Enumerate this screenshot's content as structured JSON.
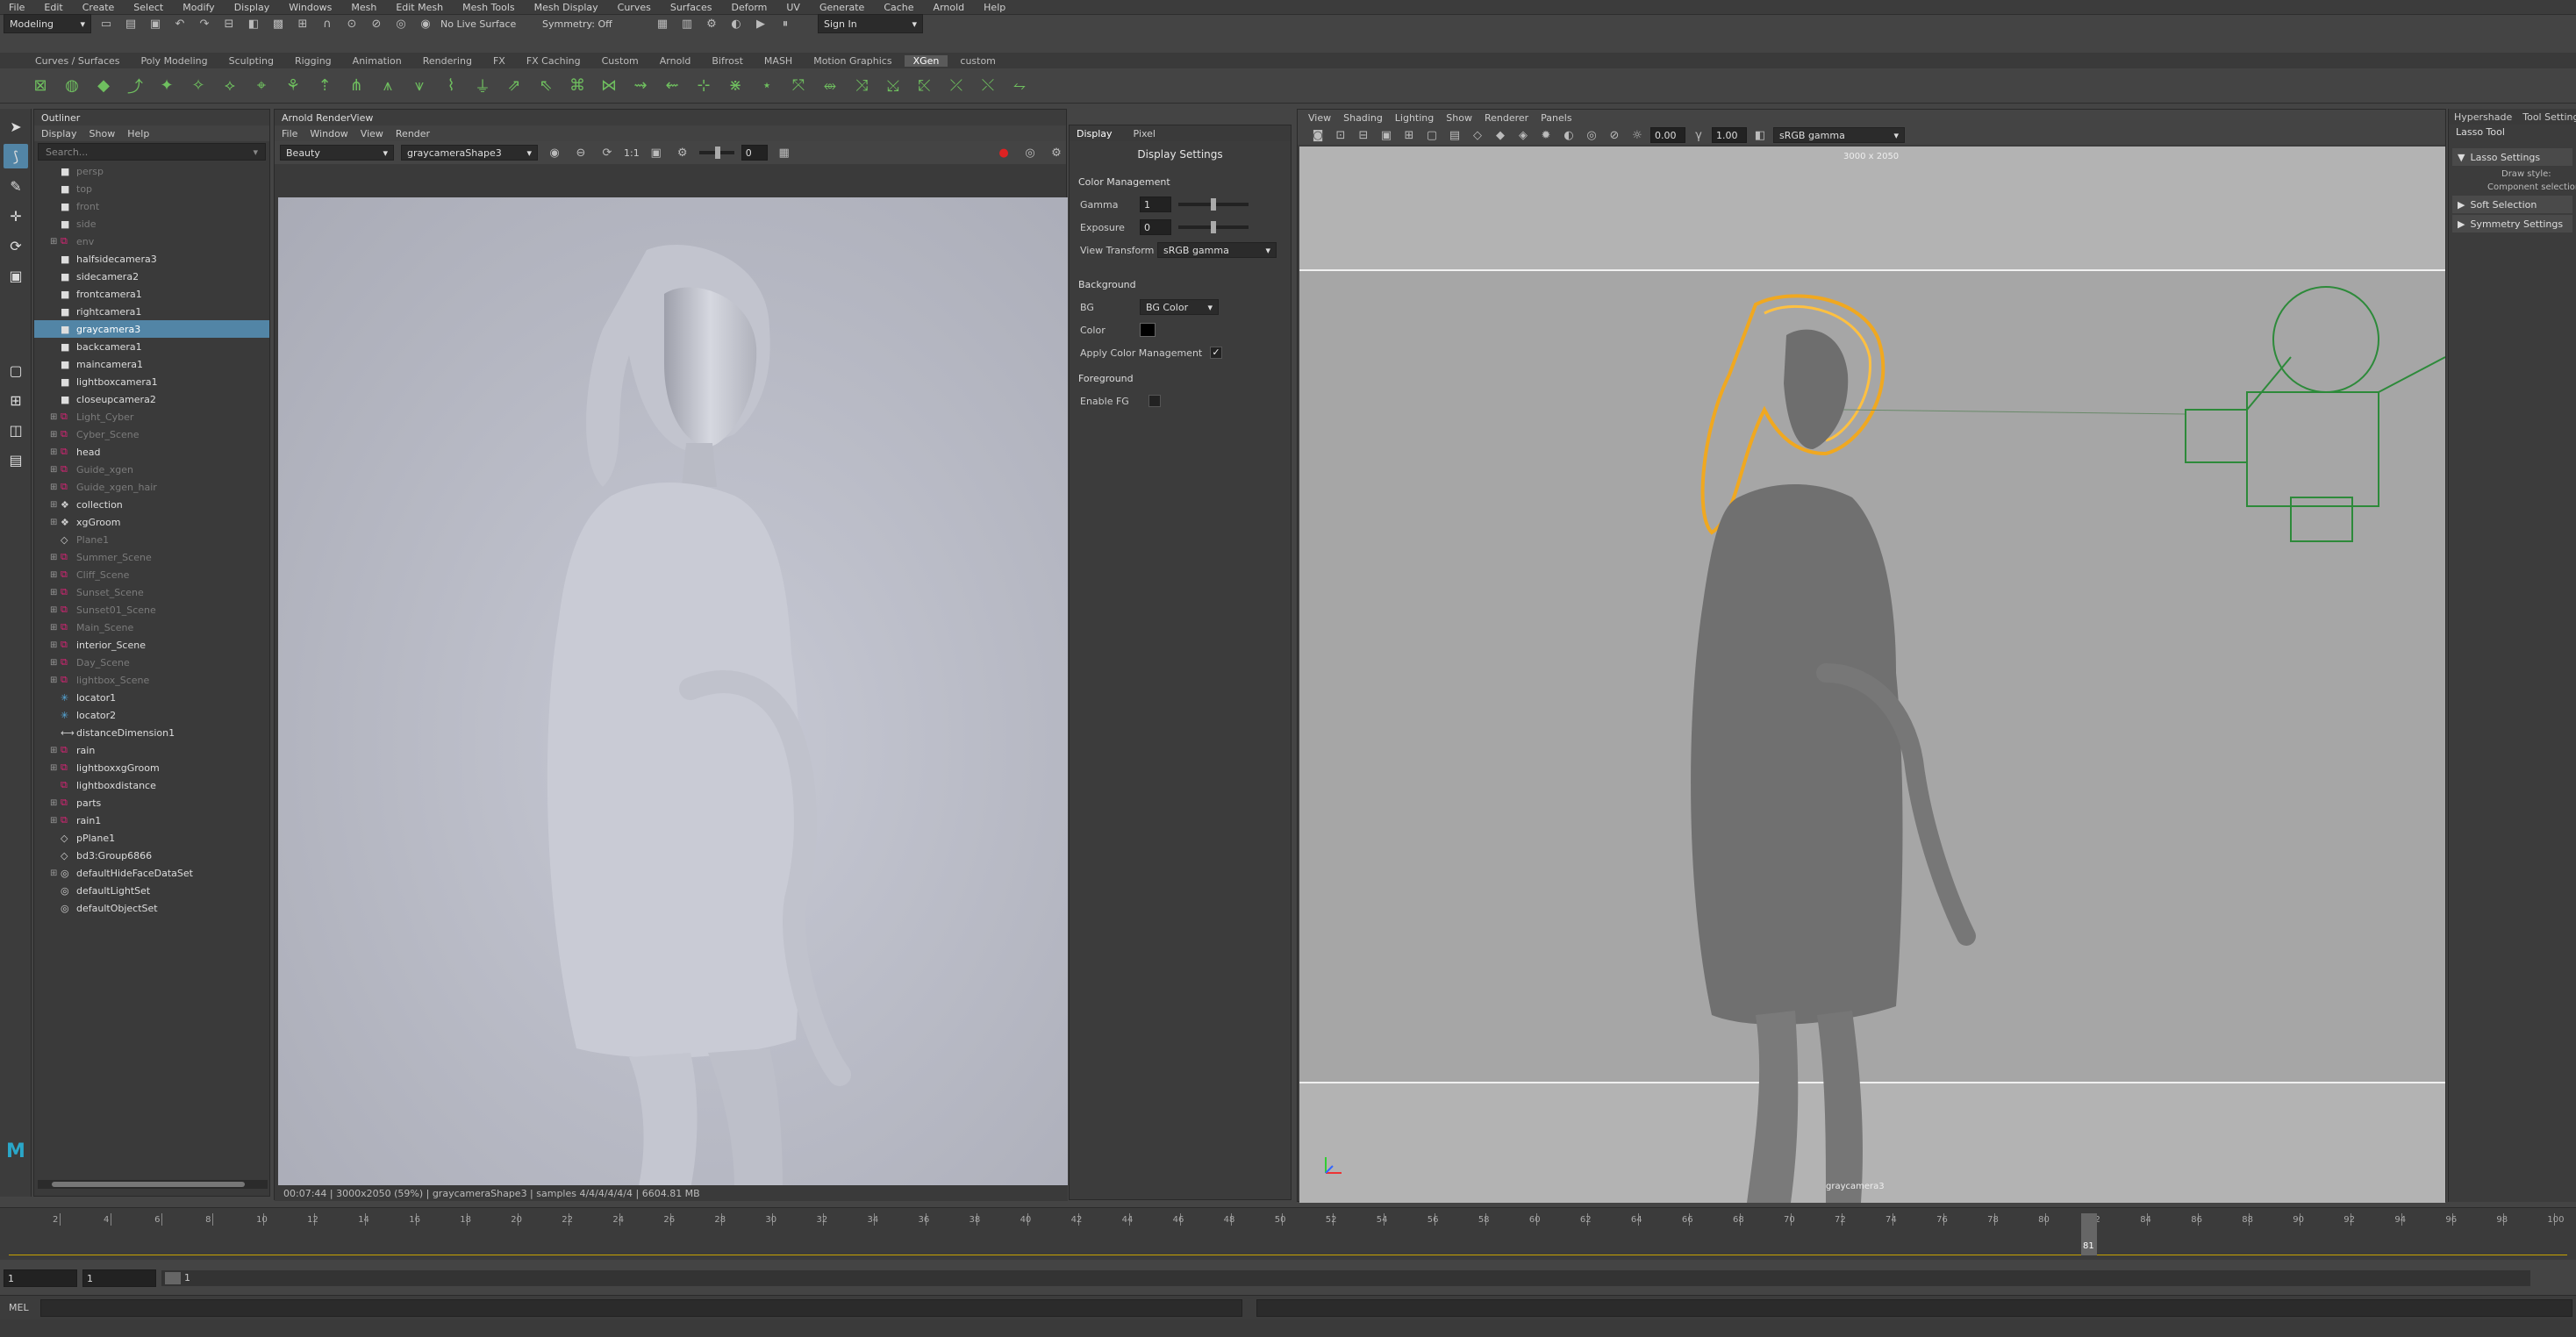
{
  "menubar": [
    "File",
    "Edit",
    "Create",
    "Select",
    "Modify",
    "Display",
    "Windows",
    "Mesh",
    "Edit Mesh",
    "Mesh Tools",
    "Mesh Display",
    "Curves",
    "Surfaces",
    "Deform",
    "UV",
    "Generate",
    "Cache",
    "Arnold",
    "Help"
  ],
  "status": {
    "mode": "Modeling",
    "live_surface": "No Live Surface",
    "symmetry": "Symmetry: Off",
    "signin": "Sign In"
  },
  "shelf_tabs": [
    "Curves / Surfaces",
    "Poly Modeling",
    "Sculpting",
    "Rigging",
    "Animation",
    "Rendering",
    "FX",
    "FX Caching",
    "Custom",
    "Arnold",
    "Bifrost",
    "MASH",
    "Motion Graphics",
    "XGen",
    "custom"
  ],
  "shelf_active": "XGen",
  "outliner": {
    "title": "Outliner",
    "menu": [
      "Display",
      "Show",
      "Help"
    ],
    "search_placeholder": "Search...",
    "items": [
      {
        "label": "persp",
        "icon": "camera",
        "dim": true
      },
      {
        "label": "top",
        "icon": "camera",
        "dim": true
      },
      {
        "label": "front",
        "icon": "camera",
        "dim": true
      },
      {
        "label": "side",
        "icon": "camera",
        "dim": true
      },
      {
        "label": "env",
        "icon": "group",
        "dim": true,
        "expand": true
      },
      {
        "label": "halfsidecamera3",
        "icon": "camera"
      },
      {
        "label": "sidecamera2",
        "icon": "camera"
      },
      {
        "label": "frontcamera1",
        "icon": "camera"
      },
      {
        "label": "rightcamera1",
        "icon": "camera"
      },
      {
        "label": "graycamera3",
        "icon": "camera",
        "selected": true
      },
      {
        "label": "backcamera1",
        "icon": "camera"
      },
      {
        "label": "maincamera1",
        "icon": "camera"
      },
      {
        "label": "lightboxcamera1",
        "icon": "camera"
      },
      {
        "label": "closeupcamera2",
        "icon": "camera"
      },
      {
        "label": "Light_Cyber",
        "icon": "group",
        "dim": true,
        "expand": true
      },
      {
        "label": "Cyber_Scene",
        "icon": "group",
        "dim": true,
        "expand": true
      },
      {
        "label": "head",
        "icon": "group",
        "expand": true
      },
      {
        "label": "Guide_xgen",
        "icon": "group",
        "dim": true,
        "expand": true
      },
      {
        "label": "Guide_xgen_hair",
        "icon": "group",
        "dim": true,
        "expand": true
      },
      {
        "label": "collection",
        "icon": "xgen",
        "expand": true
      },
      {
        "label": "xgGroom",
        "icon": "xgen",
        "expand": true
      },
      {
        "label": "Plane1",
        "icon": "mesh",
        "dim": true
      },
      {
        "label": "Summer_Scene",
        "icon": "group",
        "dim": true,
        "expand": true
      },
      {
        "label": "Cliff_Scene",
        "icon": "group",
        "dim": true,
        "expand": true
      },
      {
        "label": "Sunset_Scene",
        "icon": "group",
        "dim": true,
        "expand": true
      },
      {
        "label": "Sunset01_Scene",
        "icon": "group",
        "dim": true,
        "expand": true
      },
      {
        "label": "Main_Scene",
        "icon": "group",
        "dim": true,
        "expand": true
      },
      {
        "label": "interior_Scene",
        "icon": "group",
        "expand": true
      },
      {
        "label": "Day_Scene",
        "icon": "group",
        "dim": true,
        "expand": true
      },
      {
        "label": "lightbox_Scene",
        "icon": "group",
        "dim": true,
        "expand": true
      },
      {
        "label": "locator1",
        "icon": "locator"
      },
      {
        "label": "locator2",
        "icon": "locator"
      },
      {
        "label": "distanceDimension1",
        "icon": "dimension"
      },
      {
        "label": "rain",
        "icon": "group",
        "expand": true
      },
      {
        "label": "lightboxxgGroom",
        "icon": "group",
        "expand": true
      },
      {
        "label": "lightboxdistance",
        "icon": "group"
      },
      {
        "label": "parts",
        "icon": "group",
        "expand": true
      },
      {
        "label": "rain1",
        "icon": "group",
        "expand": true
      },
      {
        "label": "pPlane1",
        "icon": "mesh"
      },
      {
        "label": "bd3:Group6866",
        "icon": "mesh"
      },
      {
        "label": "defaultHideFaceDataSet",
        "icon": "set",
        "expand": true
      },
      {
        "label": "defaultLightSet",
        "icon": "set"
      },
      {
        "label": "defaultObjectSet",
        "icon": "set"
      }
    ]
  },
  "renderview": {
    "title": "Arnold RenderView",
    "menu": [
      "File",
      "Window",
      "View",
      "Render"
    ],
    "aov": "Beauty",
    "camera": "graycameraShape3",
    "ratio": "1:1",
    "exposure": "0",
    "status": "00:07:44 | 3000x2050 (59%) | graycameraShape3 | samples 4/4/4/4/4/4 | 6604.81 MB"
  },
  "display": {
    "tabs": [
      "Display",
      "Pixel"
    ],
    "title": "Display Settings",
    "color_mgmt": "Color Management",
    "gamma_label": "Gamma",
    "gamma": "1",
    "exposure_label": "Exposure",
    "exposure": "0",
    "gamma_level": 0.5,
    "exposure_level": 0.5,
    "view_transform_label": "View Transform",
    "view_transform": "sRGB gamma",
    "background": "Background",
    "bg_label": "BG",
    "bg_value": "BG Color",
    "color_label": "Color",
    "apply_cm": "Apply Color Management",
    "foreground": "Foreground",
    "enable_fg": "Enable FG",
    "swatch": "#000000"
  },
  "viewport": {
    "menu": [
      "View",
      "Shading",
      "Lighting",
      "Show",
      "Renderer",
      "Panels"
    ],
    "near": "0.00",
    "far": "1.00",
    "colorspace": "sRGB gamma",
    "resolution": "3000 x 2050",
    "camera_label": "graycamera3"
  },
  "rightpanel": {
    "tabs": [
      "Hypershade",
      "Tool Settings"
    ],
    "tool": "Lasso Tool",
    "sections": [
      "Lasso Settings",
      "Soft Selection",
      "Symmetry Settings"
    ],
    "draw_style": "Draw style:",
    "component": "Component selection:"
  },
  "timeline": {
    "ticks": [
      "2",
      "4",
      "6",
      "8",
      "10",
      "12",
      "14",
      "16",
      "18",
      "20",
      "22",
      "24",
      "26",
      "28",
      "30",
      "32",
      "34",
      "36",
      "38",
      "40",
      "42",
      "44",
      "46",
      "48",
      "50",
      "52",
      "54",
      "56",
      "58",
      "60",
      "62",
      "64",
      "66",
      "68",
      "70",
      "72",
      "74",
      "76",
      "78",
      "80",
      "82",
      "84",
      "86",
      "88",
      "90",
      "92",
      "94",
      "96",
      "98",
      "100"
    ],
    "current": "81",
    "current_fraction": 0.81
  },
  "range": {
    "start": "1",
    "start2": "1",
    "inner": "1"
  },
  "cmdline": {
    "label": "MEL"
  },
  "colors": {
    "selection": "#5285a6",
    "hair": "#f0a820",
    "cam": "#2d8a3a"
  }
}
